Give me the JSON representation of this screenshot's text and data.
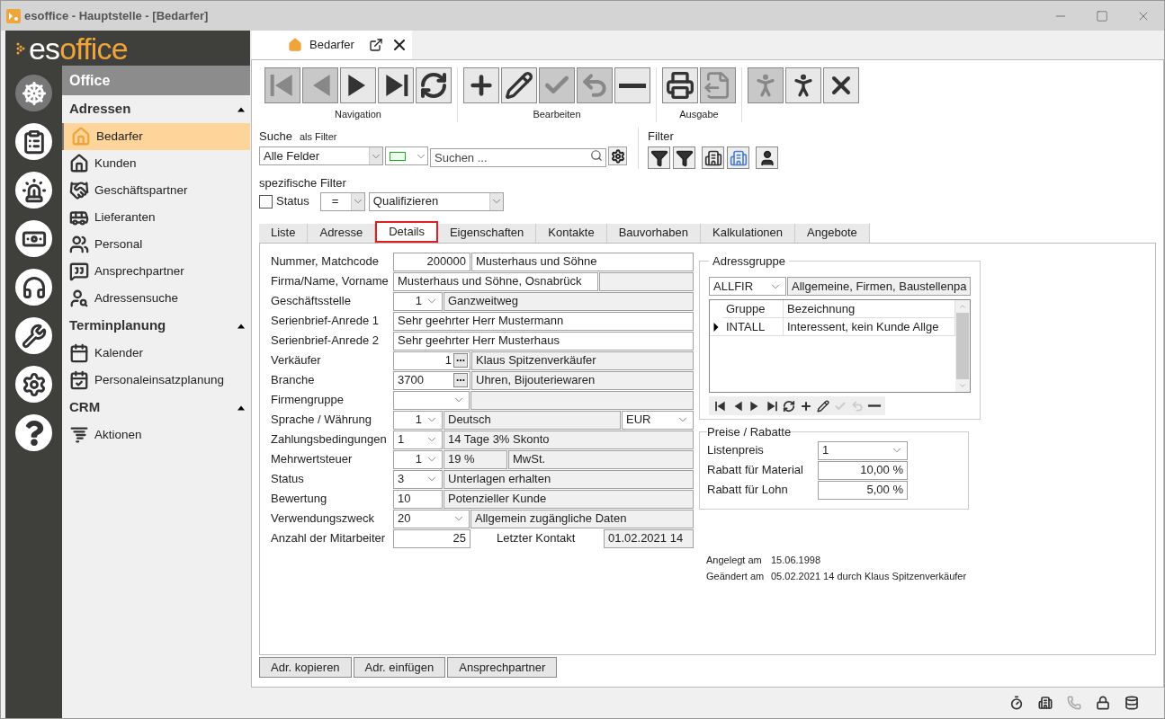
{
  "window": {
    "title": "esoffice - Hauptstelle - [Bedarfer]"
  },
  "logo": {
    "first": "es",
    "second": "office"
  },
  "rail": [
    {
      "selected": true
    },
    {
      "selected": false
    },
    {
      "selected": false
    },
    {
      "selected": false
    },
    {
      "selected": false
    },
    {
      "selected": false
    },
    {
      "selected": false
    },
    {
      "selected": false
    }
  ],
  "sidebar": {
    "title": "Office",
    "sections": [
      {
        "label": "Adressen",
        "expanded": true,
        "items": [
          {
            "label": "Bedarfer",
            "selected": true
          },
          {
            "label": "Kunden",
            "selected": false
          },
          {
            "label": "Geschäftspartner",
            "selected": false
          },
          {
            "label": "Lieferanten",
            "selected": false
          },
          {
            "label": "Personal",
            "selected": false
          },
          {
            "label": "Ansprechpartner",
            "selected": false
          },
          {
            "label": "Adressensuche",
            "selected": false
          }
        ]
      },
      {
        "label": "Terminplanung",
        "expanded": true,
        "items": [
          {
            "label": "Kalender",
            "selected": false
          },
          {
            "label": "Personaleinsatzplanung",
            "selected": false
          }
        ]
      },
      {
        "label": "CRM",
        "expanded": true,
        "items": [
          {
            "label": "Aktionen",
            "selected": false
          }
        ]
      }
    ]
  },
  "doc_tab": {
    "label": "Bedarfer"
  },
  "toolbar": [
    {
      "label": "Navigation",
      "buttons": [
        {
          "kind": "first",
          "disabled": true
        },
        {
          "kind": "prev",
          "disabled": true
        },
        {
          "kind": "next",
          "disabled": false
        },
        {
          "kind": "last",
          "disabled": false
        },
        {
          "kind": "refresh",
          "disabled": false
        }
      ]
    },
    {
      "label": "Bearbeiten",
      "buttons": [
        {
          "kind": "add",
          "disabled": false
        },
        {
          "kind": "edit",
          "disabled": false
        },
        {
          "kind": "save",
          "disabled": true
        },
        {
          "kind": "undo",
          "disabled": true
        },
        {
          "kind": "delete",
          "disabled": false
        }
      ]
    },
    {
      "label": "Ausgabe",
      "buttons": [
        {
          "kind": "print",
          "disabled": false
        },
        {
          "kind": "export",
          "disabled": true
        }
      ]
    },
    {
      "buttons": [
        {
          "kind": "walk",
          "disabled": true
        },
        {
          "kind": "run",
          "disabled": false
        },
        {
          "kind": "close",
          "disabled": false
        }
      ]
    }
  ],
  "search": {
    "label": "Suche",
    "sublabel": "als Filter",
    "field_select": "Alle Felder",
    "placeholder": "Suchen ..."
  },
  "filter": {
    "label": "Filter"
  },
  "specific_filter": {
    "label": "spezifische Filter",
    "checkbox": {
      "label": "Status",
      "checked": false
    },
    "operator": "=",
    "value": "Qualifizieren"
  },
  "tabs": [
    {
      "label": "Liste",
      "selected": false
    },
    {
      "label": "Adresse",
      "selected": false
    },
    {
      "label": "Details",
      "selected": true
    },
    {
      "label": "Eigenschaften",
      "selected": false
    },
    {
      "label": "Kontakte",
      "selected": false
    },
    {
      "label": "Bauvorhaben",
      "selected": false
    },
    {
      "label": "Kalkulationen",
      "selected": false
    },
    {
      "label": "Angebote",
      "selected": false
    }
  ],
  "details": [
    {
      "label": "Nummer, Matchcode",
      "cells": [
        {
          "kind": "number",
          "value": "200000"
        },
        {
          "kind": "text",
          "value": "Musterhaus und Söhne"
        }
      ]
    },
    {
      "label": "Firma/Name, Vorname",
      "cells": [
        {
          "kind": "text-mid",
          "value": "Musterhaus und Söhne, Osnabrück"
        },
        {
          "kind": "readonly"
        }
      ]
    },
    {
      "label": "Geschäftsstelle",
      "cells": [
        {
          "kind": "select",
          "value": "1"
        },
        {
          "kind": "readonly",
          "value": "Ganzweitweg"
        }
      ]
    },
    {
      "label": "Serienbrief-Anrede 1",
      "cells": [
        {
          "kind": "text",
          "value": "Sehr geehrter Herr Mustermann"
        }
      ]
    },
    {
      "label": "Serienbrief-Anrede 2",
      "cells": [
        {
          "kind": "text",
          "value": "Sehr geehrter Herr Musterhaus"
        }
      ]
    },
    {
      "label": "Verkäufer",
      "cells": [
        {
          "kind": "lookup",
          "value": "1"
        },
        {
          "kind": "readonly",
          "value": "Klaus Spitzenverkäufer"
        }
      ]
    },
    {
      "label": "Branche",
      "cells": [
        {
          "kind": "lookup-left",
          "value": "3700"
        },
        {
          "kind": "readonly",
          "value": "Uhren, Bijouteriewaren"
        }
      ]
    },
    {
      "label": "Firmengruppe",
      "cells": [
        {
          "kind": "select-wide"
        },
        {
          "kind": "readonly"
        }
      ]
    },
    {
      "label": "Sprache / Währung",
      "cells": [
        {
          "kind": "select",
          "value": "1"
        },
        {
          "kind": "readonly",
          "value": "Deutsch"
        },
        {
          "kind": "select-end",
          "value": "EUR"
        }
      ]
    },
    {
      "label": "Zahlungsbedingungen",
      "cells": [
        {
          "kind": "select-left",
          "value": "1"
        },
        {
          "kind": "readonly",
          "value": "14 Tage 3% Skonto"
        }
      ]
    },
    {
      "label": "Mehrwertsteuer",
      "cells": [
        {
          "kind": "select",
          "value": "1"
        },
        {
          "kind": "readonly-short",
          "value": "19 %"
        },
        {
          "kind": "readonly",
          "value": "MwSt."
        }
      ]
    },
    {
      "label": "Status",
      "cells": [
        {
          "kind": "select-left",
          "value": "3"
        },
        {
          "kind": "readonly",
          "value": "Unterlagen erhalten"
        }
      ]
    },
    {
      "label": "Bewertung",
      "cells": [
        {
          "kind": "short",
          "value": "10"
        },
        {
          "kind": "readonly",
          "value": "Potenzieller Kunde"
        }
      ]
    },
    {
      "label": "Verwendungszweck",
      "cells": [
        {
          "kind": "select-wide",
          "value": "20"
        },
        {
          "kind": "readonly",
          "value": "Allgemein zugängliche Daten"
        }
      ]
    },
    {
      "label": "Anzahl der Mitarbeiter",
      "cells": [
        {
          "kind": "number",
          "value": "25"
        },
        {
          "kind": "label",
          "value": "Letzter Kontakt"
        },
        {
          "kind": "readonly-end",
          "value": "01.02.2021 14"
        }
      ]
    }
  ],
  "address_group": {
    "title": "Adressgruppe",
    "code": "ALLFIR",
    "description": "Allgemeine, Firmen, Baustellenpa",
    "columns": [
      "Gruppe",
      "Bezeichnung"
    ],
    "rows": [
      {
        "cells": [
          "INTALL",
          "Interessent, kein Kunde Allge"
        ],
        "selected": true
      }
    ],
    "nav": [
      {
        "kind": "first",
        "disabled": false
      },
      {
        "kind": "prev",
        "disabled": false
      },
      {
        "kind": "next",
        "disabled": false
      },
      {
        "kind": "last",
        "disabled": false
      },
      {
        "kind": "refresh",
        "disabled": false
      },
      {
        "kind": "add",
        "disabled": false
      },
      {
        "kind": "edit",
        "disabled": false
      },
      {
        "kind": "save",
        "disabled": true
      },
      {
        "kind": "undo",
        "disabled": true
      },
      {
        "kind": "delete",
        "disabled": false
      }
    ]
  },
  "prices": {
    "title": "Preise / Rabatte",
    "fields": [
      {
        "label": "Listenpreis",
        "kind": "select",
        "value": "1"
      },
      {
        "label": "Rabatt für Material",
        "kind": "number",
        "value": "10,00 %"
      },
      {
        "label": "Rabatt für Lohn",
        "kind": "number",
        "value": "5,00 %"
      }
    ]
  },
  "meta": [
    {
      "label": "Angelegt am",
      "value": "15.06.1998"
    },
    {
      "label": "Geändert am",
      "value": "05.02.2021 14 durch Klaus Spitzenverkäufer"
    }
  ],
  "buttons": [
    "Adr. kopieren",
    "Adr. einfügen",
    "Ansprechpartner"
  ],
  "status_bar": [
    {
      "disabled": false
    },
    {
      "disabled": false
    },
    {
      "disabled": true
    },
    {
      "disabled": false
    },
    {
      "disabled": false
    }
  ]
}
